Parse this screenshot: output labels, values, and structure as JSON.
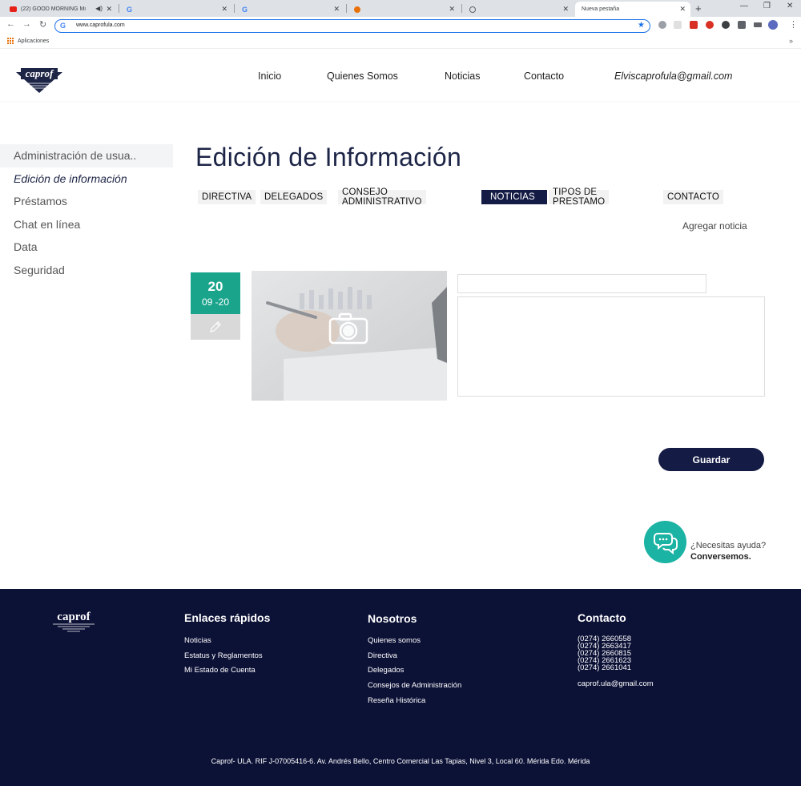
{
  "browser": {
    "tabs": [
      {
        "title": "(22) GOOD MORNING Mi"
      },
      {
        "title": ""
      },
      {
        "title": ""
      },
      {
        "title": ""
      },
      {
        "title": ""
      },
      {
        "title": "Nueva pestaña"
      }
    ],
    "url": "www.caprofula.com",
    "bookmarks_apps": "Aplicaciones"
  },
  "header": {
    "nav": [
      "Inicio",
      "Quienes Somos",
      "Noticias",
      "Contacto"
    ],
    "email": "Elviscaprofula@gmail.com"
  },
  "sidebar": {
    "items": [
      "Administración de usua..",
      "Edición de información",
      "Préstamos",
      "Chat en línea",
      "Data",
      "Seguridad"
    ]
  },
  "main": {
    "title": "Edición de Información",
    "tabs": [
      "DIRECTIVA",
      "DELEGADOS",
      "CONSEJO ADMINISTRATIVO",
      "NOTICIAS",
      "TIPOS DE PRESTAMO",
      "CONTACTO"
    ],
    "active_tab": "NOTICIAS",
    "add_news": "Agregar noticia",
    "news": {
      "day": "20",
      "month": "09 -20",
      "title_value": "",
      "body_value": ""
    },
    "save_label": "Guardar"
  },
  "chat": {
    "line1": "¿Necesitas ayuda?",
    "line2": "Conversemos."
  },
  "footer": {
    "logo_text": "caprof",
    "quick_links_title": "Enlaces rápidos",
    "quick_links": [
      "Noticias",
      "Estatus y Reglamentos",
      "Mi Estado de Cuenta"
    ],
    "about_title": "Nosotros",
    "about_links": [
      "Quienes somos",
      "Directiva",
      "Delegados",
      "Consejos de Administración",
      "Reseña Histórica"
    ],
    "contact_title": "Contacto",
    "phones": [
      "(0274) 2660558",
      "(0274) 2663417",
      "(0274) 2660815",
      "(0274)  2661623",
      "(0274) 2661041"
    ],
    "contact_email": "caprof.ula@gmail.com",
    "copyright": "Caprof- ULA. RIF J-07005416-6.  Av. Andrés Bello, Centro Comercial Las Tapias, Nivel 3, Local 60. Mérida Edo. Mérida"
  },
  "colors": {
    "navy": "#141b45",
    "teal": "#1aa48c",
    "footer_bg": "#0c1136"
  }
}
